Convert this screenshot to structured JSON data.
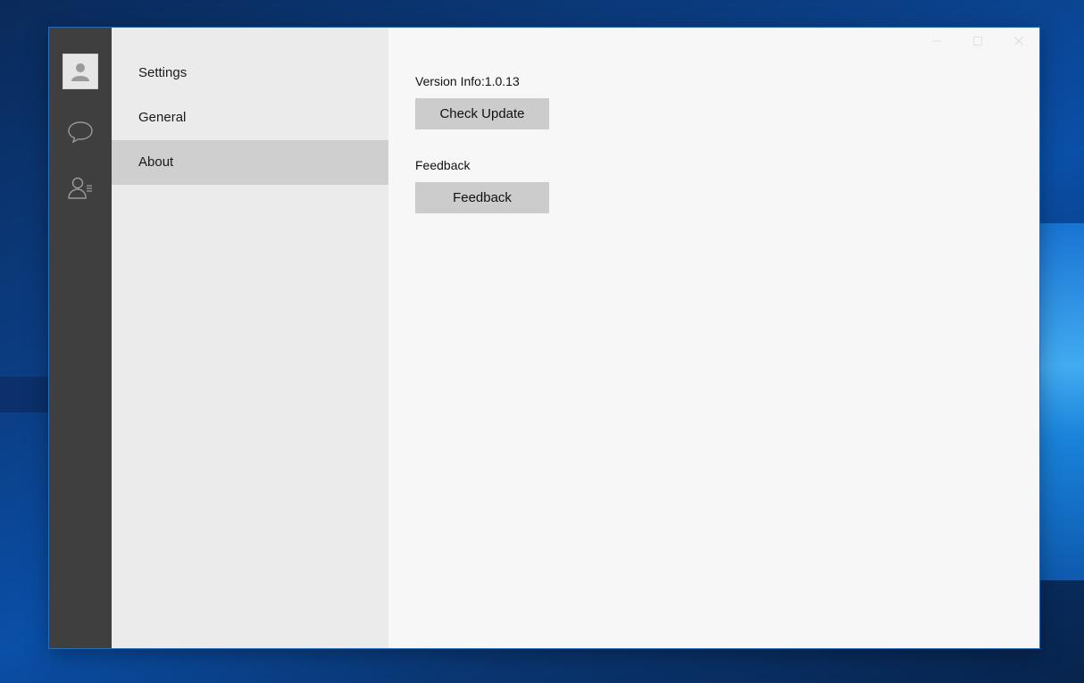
{
  "sidebar": {
    "icons": [
      "user-avatar-icon",
      "chat-bubble-icon",
      "contacts-icon"
    ]
  },
  "menu": {
    "items": [
      {
        "label": "Settings",
        "active": false
      },
      {
        "label": "General",
        "active": false
      },
      {
        "label": "About",
        "active": true
      }
    ]
  },
  "about": {
    "version_label": "Version Info:1.0.13",
    "check_update_label": "Check Update",
    "feedback_label": "Feedback",
    "feedback_button_label": "Feedback"
  },
  "window_controls": [
    "minimize-icon",
    "maximize-icon",
    "close-icon"
  ],
  "colors": {
    "rail_bg": "#3f3f3f",
    "menu_bg": "#ebebeb",
    "menu_active_bg": "#cfcfcf",
    "content_bg": "#f7f7f7",
    "button_bg": "#cccccc"
  }
}
